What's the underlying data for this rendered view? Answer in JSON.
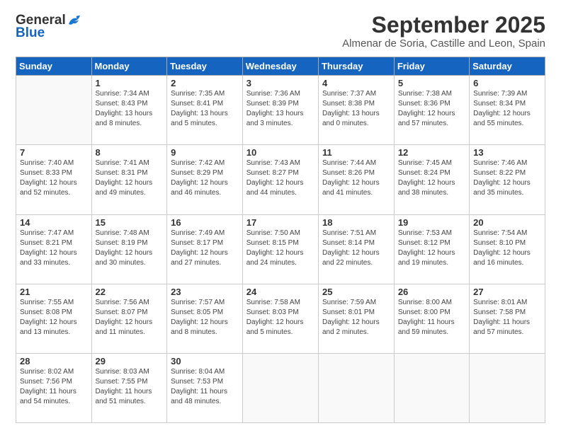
{
  "logo": {
    "general": "General",
    "blue": "Blue"
  },
  "header": {
    "month": "September 2025",
    "location": "Almenar de Soria, Castille and Leon, Spain"
  },
  "weekdays": [
    "Sunday",
    "Monday",
    "Tuesday",
    "Wednesday",
    "Thursday",
    "Friday",
    "Saturday"
  ],
  "weeks": [
    [
      {
        "day": null,
        "info": null
      },
      {
        "day": "1",
        "info": "Sunrise: 7:34 AM\nSunset: 8:43 PM\nDaylight: 13 hours\nand 8 minutes."
      },
      {
        "day": "2",
        "info": "Sunrise: 7:35 AM\nSunset: 8:41 PM\nDaylight: 13 hours\nand 5 minutes."
      },
      {
        "day": "3",
        "info": "Sunrise: 7:36 AM\nSunset: 8:39 PM\nDaylight: 13 hours\nand 3 minutes."
      },
      {
        "day": "4",
        "info": "Sunrise: 7:37 AM\nSunset: 8:38 PM\nDaylight: 13 hours\nand 0 minutes."
      },
      {
        "day": "5",
        "info": "Sunrise: 7:38 AM\nSunset: 8:36 PM\nDaylight: 12 hours\nand 57 minutes."
      },
      {
        "day": "6",
        "info": "Sunrise: 7:39 AM\nSunset: 8:34 PM\nDaylight: 12 hours\nand 55 minutes."
      }
    ],
    [
      {
        "day": "7",
        "info": "Sunrise: 7:40 AM\nSunset: 8:33 PM\nDaylight: 12 hours\nand 52 minutes."
      },
      {
        "day": "8",
        "info": "Sunrise: 7:41 AM\nSunset: 8:31 PM\nDaylight: 12 hours\nand 49 minutes."
      },
      {
        "day": "9",
        "info": "Sunrise: 7:42 AM\nSunset: 8:29 PM\nDaylight: 12 hours\nand 46 minutes."
      },
      {
        "day": "10",
        "info": "Sunrise: 7:43 AM\nSunset: 8:27 PM\nDaylight: 12 hours\nand 44 minutes."
      },
      {
        "day": "11",
        "info": "Sunrise: 7:44 AM\nSunset: 8:26 PM\nDaylight: 12 hours\nand 41 minutes."
      },
      {
        "day": "12",
        "info": "Sunrise: 7:45 AM\nSunset: 8:24 PM\nDaylight: 12 hours\nand 38 minutes."
      },
      {
        "day": "13",
        "info": "Sunrise: 7:46 AM\nSunset: 8:22 PM\nDaylight: 12 hours\nand 35 minutes."
      }
    ],
    [
      {
        "day": "14",
        "info": "Sunrise: 7:47 AM\nSunset: 8:21 PM\nDaylight: 12 hours\nand 33 minutes."
      },
      {
        "day": "15",
        "info": "Sunrise: 7:48 AM\nSunset: 8:19 PM\nDaylight: 12 hours\nand 30 minutes."
      },
      {
        "day": "16",
        "info": "Sunrise: 7:49 AM\nSunset: 8:17 PM\nDaylight: 12 hours\nand 27 minutes."
      },
      {
        "day": "17",
        "info": "Sunrise: 7:50 AM\nSunset: 8:15 PM\nDaylight: 12 hours\nand 24 minutes."
      },
      {
        "day": "18",
        "info": "Sunrise: 7:51 AM\nSunset: 8:14 PM\nDaylight: 12 hours\nand 22 minutes."
      },
      {
        "day": "19",
        "info": "Sunrise: 7:53 AM\nSunset: 8:12 PM\nDaylight: 12 hours\nand 19 minutes."
      },
      {
        "day": "20",
        "info": "Sunrise: 7:54 AM\nSunset: 8:10 PM\nDaylight: 12 hours\nand 16 minutes."
      }
    ],
    [
      {
        "day": "21",
        "info": "Sunrise: 7:55 AM\nSunset: 8:08 PM\nDaylight: 12 hours\nand 13 minutes."
      },
      {
        "day": "22",
        "info": "Sunrise: 7:56 AM\nSunset: 8:07 PM\nDaylight: 12 hours\nand 11 minutes."
      },
      {
        "day": "23",
        "info": "Sunrise: 7:57 AM\nSunset: 8:05 PM\nDaylight: 12 hours\nand 8 minutes."
      },
      {
        "day": "24",
        "info": "Sunrise: 7:58 AM\nSunset: 8:03 PM\nDaylight: 12 hours\nand 5 minutes."
      },
      {
        "day": "25",
        "info": "Sunrise: 7:59 AM\nSunset: 8:01 PM\nDaylight: 12 hours\nand 2 minutes."
      },
      {
        "day": "26",
        "info": "Sunrise: 8:00 AM\nSunset: 8:00 PM\nDaylight: 11 hours\nand 59 minutes."
      },
      {
        "day": "27",
        "info": "Sunrise: 8:01 AM\nSunset: 7:58 PM\nDaylight: 11 hours\nand 57 minutes."
      }
    ],
    [
      {
        "day": "28",
        "info": "Sunrise: 8:02 AM\nSunset: 7:56 PM\nDaylight: 11 hours\nand 54 minutes."
      },
      {
        "day": "29",
        "info": "Sunrise: 8:03 AM\nSunset: 7:55 PM\nDaylight: 11 hours\nand 51 minutes."
      },
      {
        "day": "30",
        "info": "Sunrise: 8:04 AM\nSunset: 7:53 PM\nDaylight: 11 hours\nand 48 minutes."
      },
      {
        "day": null,
        "info": null
      },
      {
        "day": null,
        "info": null
      },
      {
        "day": null,
        "info": null
      },
      {
        "day": null,
        "info": null
      }
    ]
  ]
}
